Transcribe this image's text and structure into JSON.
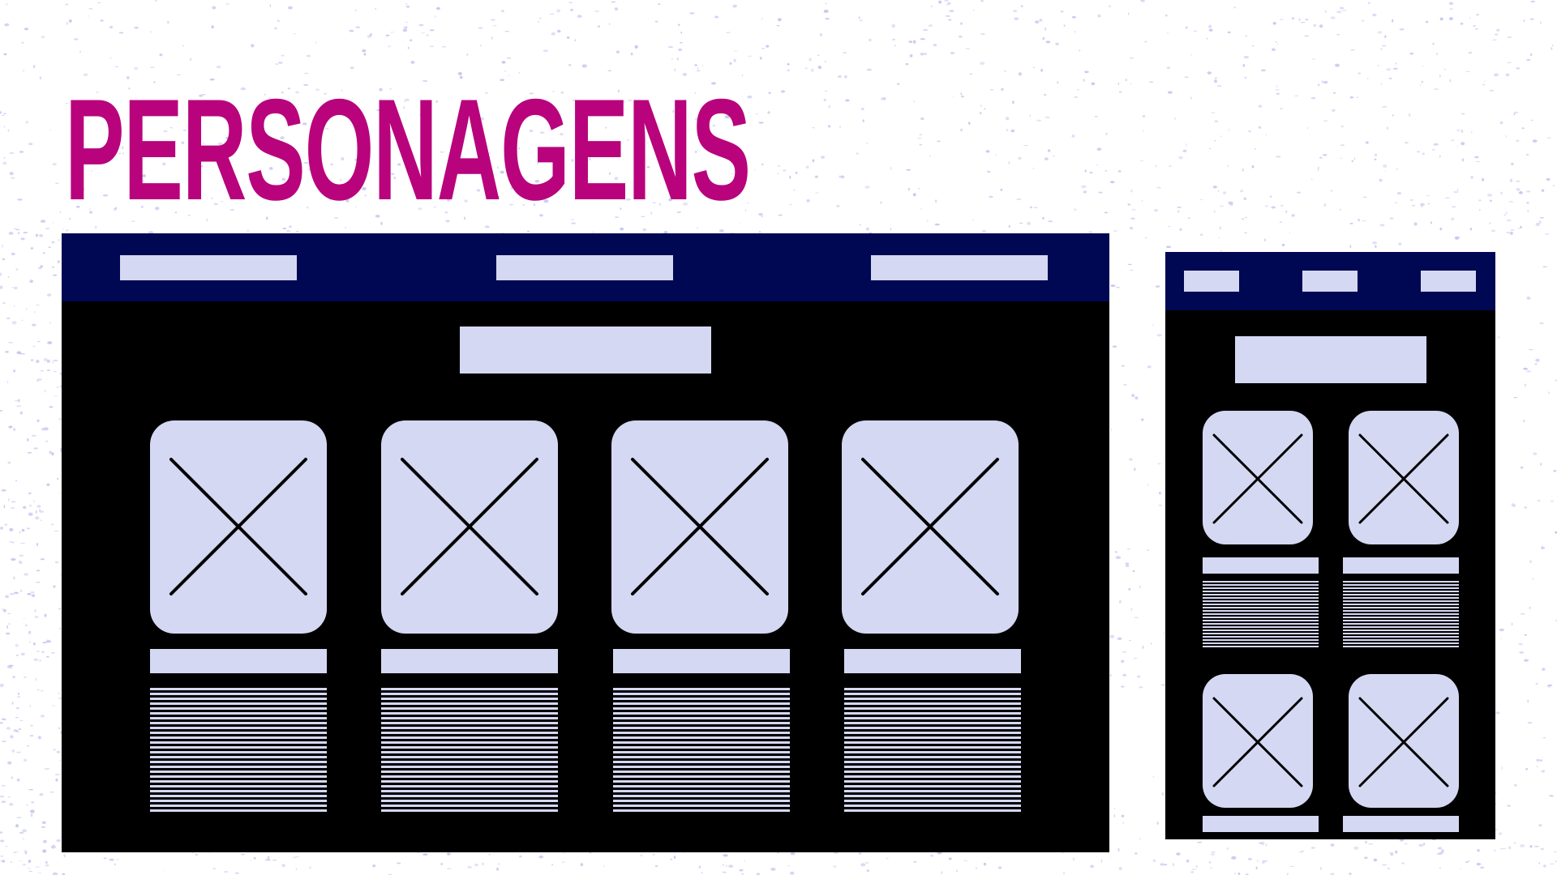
{
  "title": "PERSONAGENS",
  "colors": {
    "title": "#b8037c",
    "navbar": "#000853",
    "frame": "#000000",
    "placeholder": "#d5d8f2",
    "speckle": "#c3c7ee"
  },
  "desktop_wireframe": {
    "nav_placeholders": 3,
    "header_placeholders": 1,
    "cards": 4,
    "card_icon": "image-placeholder-cross-icon"
  },
  "mobile_wireframe": {
    "nav_placeholders": 3,
    "header_placeholders": 1,
    "cards": 4,
    "card_icon": "image-placeholder-cross-icon"
  }
}
